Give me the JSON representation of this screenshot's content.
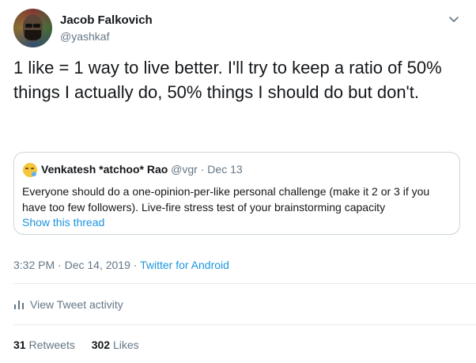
{
  "author": {
    "name": "Jacob Falkovich",
    "handle": "@yashkaf"
  },
  "tweet": {
    "text": "1 like = 1 way to live better. I'll try to keep a ratio of 50% things I actually do, 50% things I should do but don't."
  },
  "quoted_tweet": {
    "author_name": "Venkatesh *atchoo* Rao",
    "handle": "@vgr",
    "date": "Dec 13",
    "text": "Everyone should do a one-opinion-per-like personal challenge (make it 2 or 3 if you have too few followers). Live-fire stress test of your brainstorming capacity",
    "show_thread_label": "Show this thread",
    "emoji_icon": "sneezing-face-icon"
  },
  "meta": {
    "time": "3:32 PM",
    "date": "Dec 14, 2019",
    "source": "Twitter for Android"
  },
  "activity": {
    "label": "View Tweet activity"
  },
  "stats": {
    "retweets_count": "31",
    "retweets_label": "Retweets",
    "likes_count": "302",
    "likes_label": "Likes"
  },
  "colors": {
    "link": "#1b95e0",
    "secondary_text": "#657786",
    "border": "#ccd6dd"
  }
}
